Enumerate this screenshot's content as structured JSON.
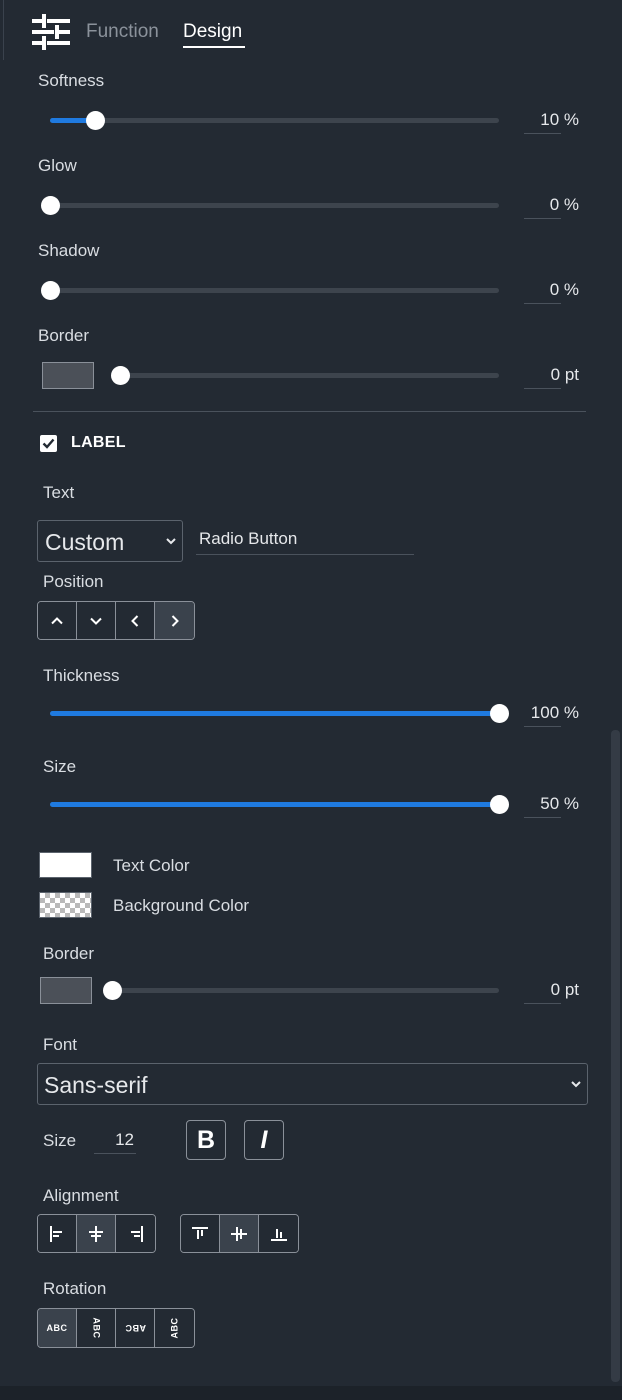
{
  "header": {
    "tabs": [
      {
        "label": "Function",
        "active": false
      },
      {
        "label": "Design",
        "active": true
      }
    ],
    "logo_icon": "sliders-icon"
  },
  "effects": {
    "softness": {
      "label": "Softness",
      "value_text": "10 %",
      "fraction": 0.1
    },
    "glow": {
      "label": "Glow",
      "value_text": "0 %",
      "fraction": 0
    },
    "shadow": {
      "label": "Shadow",
      "value_text": "0 %",
      "fraction": 0
    },
    "border": {
      "label": "Border",
      "value_text": "0 pt",
      "fraction": 0,
      "swatch_color": "#4b5058"
    }
  },
  "label_section": {
    "title": "LABEL",
    "enabled": true,
    "text": {
      "label": "Text",
      "mode": "Custom",
      "value": "Radio Button"
    },
    "position": {
      "label": "Position",
      "options": [
        "up",
        "down",
        "left",
        "right"
      ],
      "selected": "right"
    },
    "thickness": {
      "label": "Thickness",
      "value_text": "100 %",
      "fraction": 1.0
    },
    "size_slider": {
      "label": "Size",
      "value_text": "50 %",
      "fraction": 1.0
    },
    "text_color": {
      "label": "Text Color",
      "color": "#ffffff"
    },
    "background_color": {
      "label": "Background Color",
      "color": "transparent"
    },
    "border": {
      "label": "Border",
      "value_text": "0 pt",
      "fraction": 0,
      "swatch_color": "#4b5058"
    },
    "font": {
      "label": "Font",
      "value": "Sans-serif"
    },
    "font_size": {
      "label": "Size",
      "value": "12"
    },
    "bold_label": "B",
    "italic_label": "I",
    "alignment": {
      "label": "Alignment",
      "horizontal": [
        "left",
        "center",
        "right"
      ],
      "horizontal_selected": "center",
      "vertical": [
        "top",
        "middle",
        "bottom"
      ],
      "vertical_selected": "middle"
    },
    "rotation": {
      "label": "Rotation",
      "options": [
        "ABC",
        "ABC",
        "ABC",
        "ABC"
      ],
      "selected_index": 0
    }
  },
  "colors": {
    "accent": "#1f7ae0",
    "background": "#232a33"
  }
}
